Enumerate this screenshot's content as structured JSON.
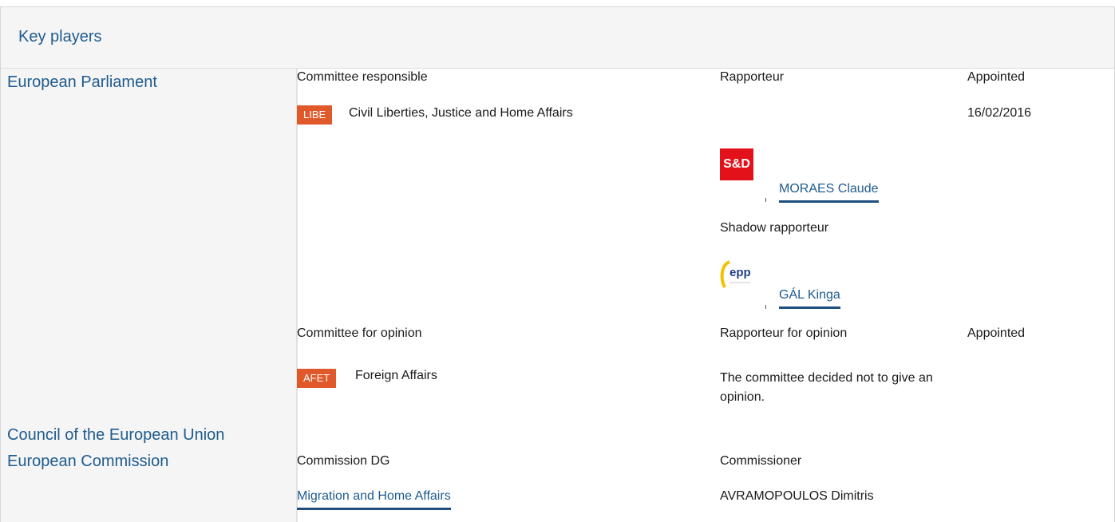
{
  "header": {
    "title": "Key players"
  },
  "institutions": {
    "ep": "European Parliament",
    "council": "Council of the European Union",
    "commission": "European Commission"
  },
  "responsible": {
    "col_committee": "Committee responsible",
    "col_rapporteur": "Rapporteur",
    "col_appointed": "Appointed",
    "committee_code": "LIBE",
    "committee_name": "Civil Liberties, Justice and Home Affairs",
    "appointed_date": "16/02/2016",
    "rapporteur_group_logo": "S&D",
    "rapporteur_name": "MORAES Claude",
    "shadow_label": "Shadow rapporteur",
    "shadow_group_logo": "epp",
    "shadow_name": "GÁL Kinga"
  },
  "opinion": {
    "col_committee": "Committee for opinion",
    "col_rapporteur": "Rapporteur for opinion",
    "col_appointed": "Appointed",
    "committee_code": "AFET",
    "committee_name": "Foreign Affairs",
    "note": "The committee decided not to give an opinion."
  },
  "commission": {
    "col_dg": "Commission DG",
    "col_commissioner": "Commissioner",
    "dg_name": "Migration and Home Affairs",
    "commissioner_name": "AVRAMOPOULOS Dimitris"
  },
  "colors": {
    "link": "#1e5b8e",
    "badge": "#e0592a",
    "sd_red": "#e3121a",
    "panel_bg": "#f5f5f5"
  }
}
